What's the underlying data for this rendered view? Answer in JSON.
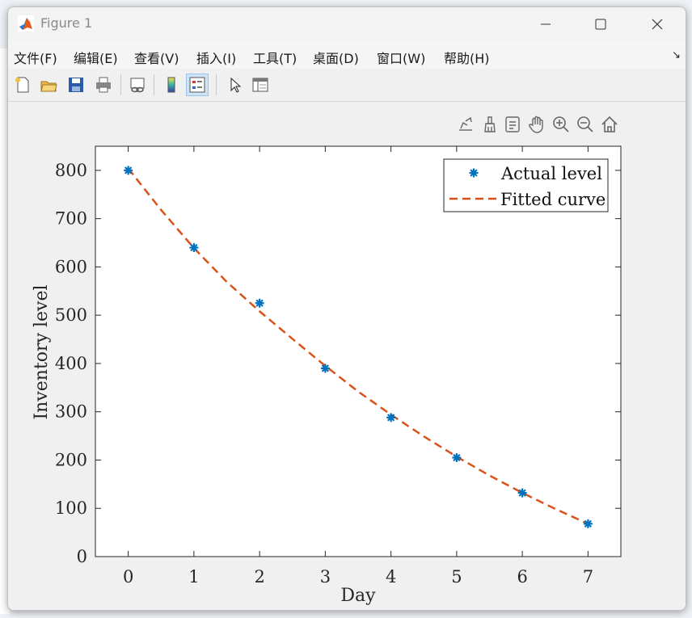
{
  "window": {
    "title": "Figure 1"
  },
  "menu": {
    "items": [
      "文件(F)",
      "编辑(E)",
      "查看(V)",
      "插入(I)",
      "工具(T)",
      "桌面(D)",
      "窗口(W)",
      "帮助(H)"
    ]
  },
  "toolbar": {
    "buttons": [
      "new-figure-icon",
      "open-icon",
      "save-icon",
      "print-icon",
      "link-plot-icon",
      "insert-colorbar-icon",
      "insert-legend-icon",
      "edit-plot-icon",
      "property-inspector-icon"
    ]
  },
  "axes_toolbar": {
    "buttons": [
      "export-icon",
      "brush-icon",
      "datatip-icon",
      "pan-icon",
      "zoom-in-icon",
      "zoom-out-icon",
      "restore-view-icon"
    ]
  },
  "chart_data": {
    "type": "line",
    "title": "",
    "xlabel": "Day",
    "ylabel": "Inventory level",
    "xlim": [
      -0.5,
      7.5
    ],
    "ylim": [
      0,
      850
    ],
    "xticks": [
      0,
      1,
      2,
      3,
      4,
      5,
      6,
      7
    ],
    "yticks": [
      0,
      100,
      200,
      300,
      400,
      500,
      600,
      700,
      800
    ],
    "grid": false,
    "legend_location": "top-right",
    "series": [
      {
        "name": "Actual level",
        "style": "markers",
        "marker": "asterisk",
        "color": "#0072BD",
        "x": [
          0,
          1,
          2,
          3,
          4,
          5,
          6,
          7
        ],
        "y": [
          800,
          640,
          525,
          390,
          288,
          205,
          132,
          68
        ]
      },
      {
        "name": "Fitted curve",
        "style": "dashed-line",
        "color": "#D95319",
        "x": [
          0,
          0.5,
          1,
          1.5,
          2,
          2.5,
          3,
          3.5,
          4,
          4.5,
          5,
          5.5,
          6,
          6.5,
          7
        ],
        "y": [
          804,
          718,
          639,
          569,
          508,
          451,
          395,
          342,
          294,
          249,
          207,
          168,
          132,
          99,
          68
        ]
      }
    ]
  }
}
